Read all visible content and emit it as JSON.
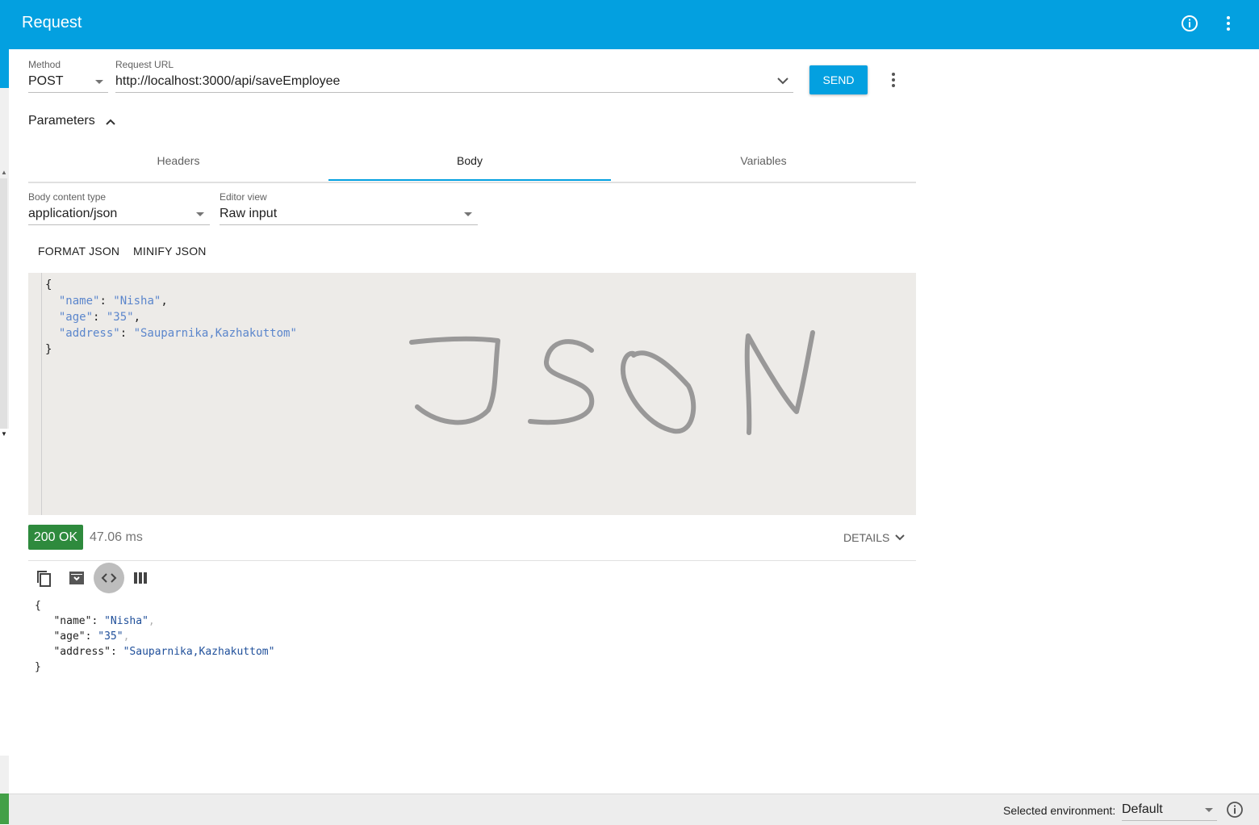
{
  "app": {
    "title": "Request"
  },
  "request": {
    "method_label": "Method",
    "method_value": "POST",
    "url_label": "Request URL",
    "url_value": "http://localhost:3000/api/saveEmployee",
    "send_label": "SEND"
  },
  "parameters": {
    "label": "Parameters",
    "expanded": true
  },
  "tabs": [
    {
      "label": "Headers",
      "active": false
    },
    {
      "label": "Body",
      "active": true
    },
    {
      "label": "Variables",
      "active": false
    }
  ],
  "body": {
    "content_type_label": "Body content type",
    "content_type_value": "application/json",
    "editor_view_label": "Editor view",
    "editor_view_value": "Raw input",
    "format_json_label": "FORMAT JSON",
    "minify_json_label": "MINIFY JSON",
    "editor_lines": {
      "open": "{",
      "l1_key": "\"name\"",
      "l1_val": "\"Nisha\"",
      "l2_key": "\"age\"",
      "l2_val": "\"35\"",
      "l3_key": "\"address\"",
      "l3_val": "\"Sauparnika,Kazhakuttom\"",
      "close": "}"
    },
    "handwriting_text": "JSON"
  },
  "response": {
    "status": "200 OK",
    "status_color": "#2e8a3d",
    "time": "47.06 ms",
    "details_label": "DETAILS",
    "toolbar_icons": [
      "copy-icon",
      "save-icon",
      "code-view-icon",
      "columns-view-icon"
    ],
    "lines": {
      "open": "{",
      "l1_key": "\"name\"",
      "l1_val": "\"Nisha\"",
      "l2_key": "\"age\"",
      "l2_val": "\"35\"",
      "l3_key": "\"address\"",
      "l3_val": "\"Sauparnika,Kazhakuttom\"",
      "close": "}"
    }
  },
  "footer": {
    "env_label": "Selected environment:",
    "env_value": "Default"
  },
  "colors": {
    "accent": "#03a0e0",
    "success": "#2e8a3d"
  }
}
